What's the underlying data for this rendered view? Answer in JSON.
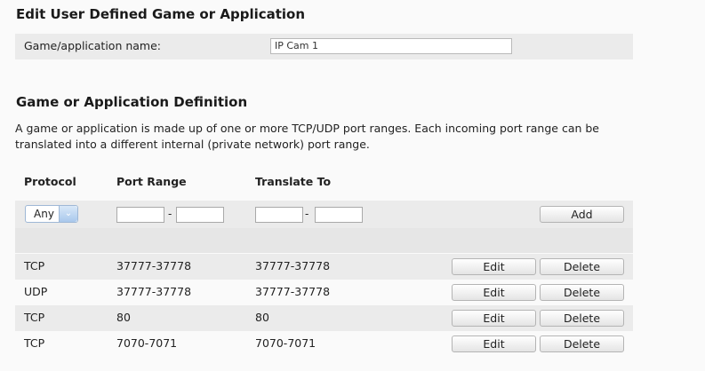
{
  "edit_section": {
    "title": "Edit User Defined Game or Application",
    "name_label": "Game/application name:",
    "name_value": "IP Cam 1"
  },
  "definition_section": {
    "title": "Game or Application Definition",
    "description": "A game or application is made up of one or more TCP/UDP port ranges. Each incoming port range can be translated into a different internal (private network) port range."
  },
  "table": {
    "headers": {
      "protocol": "Protocol",
      "port_range": "Port Range",
      "translate_to": "Translate To"
    },
    "add_row": {
      "protocol_selected": "Any",
      "port_range_from": "",
      "port_range_to": "",
      "translate_from": "",
      "translate_to": "",
      "range_separator": "-",
      "add_label": "Add"
    },
    "rows": [
      {
        "protocol": "TCP",
        "port_range": "37777-37778",
        "translate_to": "37777-37778",
        "edit_label": "Edit",
        "delete_label": "Delete"
      },
      {
        "protocol": "UDP",
        "port_range": "37777-37778",
        "translate_to": "37777-37778",
        "edit_label": "Edit",
        "delete_label": "Delete"
      },
      {
        "protocol": "TCP",
        "port_range": "80",
        "translate_to": "80",
        "edit_label": "Edit",
        "delete_label": "Delete"
      },
      {
        "protocol": "TCP",
        "port_range": "7070-7071",
        "translate_to": "7070-7071",
        "edit_label": "Edit",
        "delete_label": "Delete"
      }
    ]
  },
  "icons": {
    "select_arrow": "chevron-down-icon"
  }
}
